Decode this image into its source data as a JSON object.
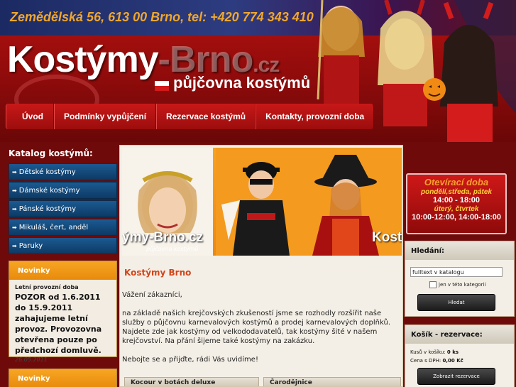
{
  "header": {
    "address": "Zemědělská 56, 613 00 Brno, tel: +420 774 343 410",
    "logo_main": "Kostýmy",
    "logo_rest": "-Brno",
    "logo_tld": ".cz",
    "slogan": "půjčovna kostýmů"
  },
  "nav": {
    "items": [
      {
        "label": "Úvod"
      },
      {
        "label": "Podmínky vypůjčení"
      },
      {
        "label": "Rezervace kostýmů"
      },
      {
        "label": "Kontakty, provozní doba"
      }
    ]
  },
  "sidebar": {
    "catalog_title": "Katalog kostýmů:",
    "items": [
      {
        "label": "Dětské kostýmy"
      },
      {
        "label": "Dámské kostýmy"
      },
      {
        "label": "Pánské kostýmy"
      },
      {
        "label": "Mikuláš, čert, anděl"
      },
      {
        "label": "Paruky"
      }
    ],
    "news": {
      "heading": "Novinky",
      "title": "Letní provozní doba",
      "text": "POZOR od 1.6.2011 do 15.9.2011 zahajujeme letní provoz. Provozovna otevřena pouze po předchozí domluvě.",
      "date": "26.05.2011"
    },
    "news2": {
      "heading": "Novinky"
    }
  },
  "banner": {
    "caption_left": "ýmy-Brno.cz",
    "caption_sub": "půjčovna kostýmů",
    "caption_right": "Kost"
  },
  "main": {
    "title": "Kostýmy Brno",
    "greeting": "Vážení zákazníci,",
    "paragraph1": "na základě našich krejčovských zkušeností jsme se rozhodly rozšířit naše služby o půjčovnu karnevalových kostýmů a prodej karnevalových doplňků.",
    "paragraph2": "Najdete zde jak kostýmy od velkododavatelů, tak kostýmy šité v našem krejčovství. Na přání šijeme také kostýmy na zakázku.",
    "closing": "Nebojte se a přijďte, rádi Vás uvidíme!",
    "product_tabs": [
      {
        "label": "Kocour v botách deluxe"
      },
      {
        "label": "Čarodějnice"
      }
    ]
  },
  "hours": {
    "title": "Otevírací doba",
    "days1": "pondělí,středa, pátek",
    "time1": "14:00 - 18:00",
    "days2": "úterý, čtvrtek",
    "time2": "10:00-12:00, 14:00-18:00"
  },
  "search": {
    "heading": "Hledání:",
    "value": "fulltext v katalogu",
    "checkbox_label": "jen v této kategorii",
    "button": "Hledat"
  },
  "cart": {
    "heading": "Košík - rezervace:",
    "items_label": "Kusů v košíku:",
    "items_value": "0 ks",
    "price_label": "Cena s DPH:",
    "price_value": "0,00 Kč",
    "button": "Zobrazit rezervace"
  },
  "colors": {
    "header_red": "#b3120f",
    "address_orange": "#f0a72c",
    "title_orange": "#d2451a",
    "catalog_blue": "#1b5a92",
    "news_orange": "#f7a623"
  }
}
